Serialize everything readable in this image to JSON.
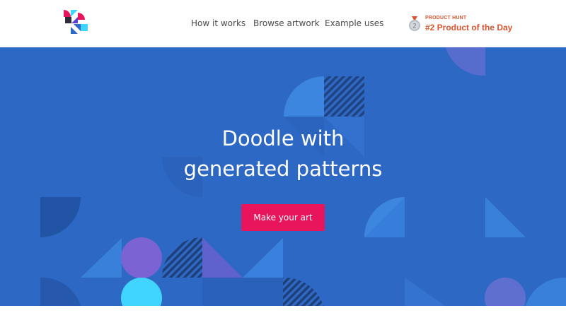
{
  "header": {
    "nav": [
      {
        "label": "How it works"
      },
      {
        "label": "Browse artwork"
      },
      {
        "label": "Example uses"
      }
    ],
    "product_hunt": {
      "kicker": "PRODUCT HUNT",
      "title": "#2 Product of the Day",
      "medal_number": "2"
    }
  },
  "hero": {
    "title_line1": "Doodle with",
    "title_line2": "generated patterns",
    "cta_label": "Make your art"
  },
  "colors": {
    "hero_bg": "#2d68c4",
    "cta": "#e8155c",
    "product_hunt": "#da552f",
    "logo": [
      "#e8155c",
      "#2c2c3a",
      "#3fd5ff",
      "#2d68c4",
      "#5b3fd0"
    ]
  }
}
